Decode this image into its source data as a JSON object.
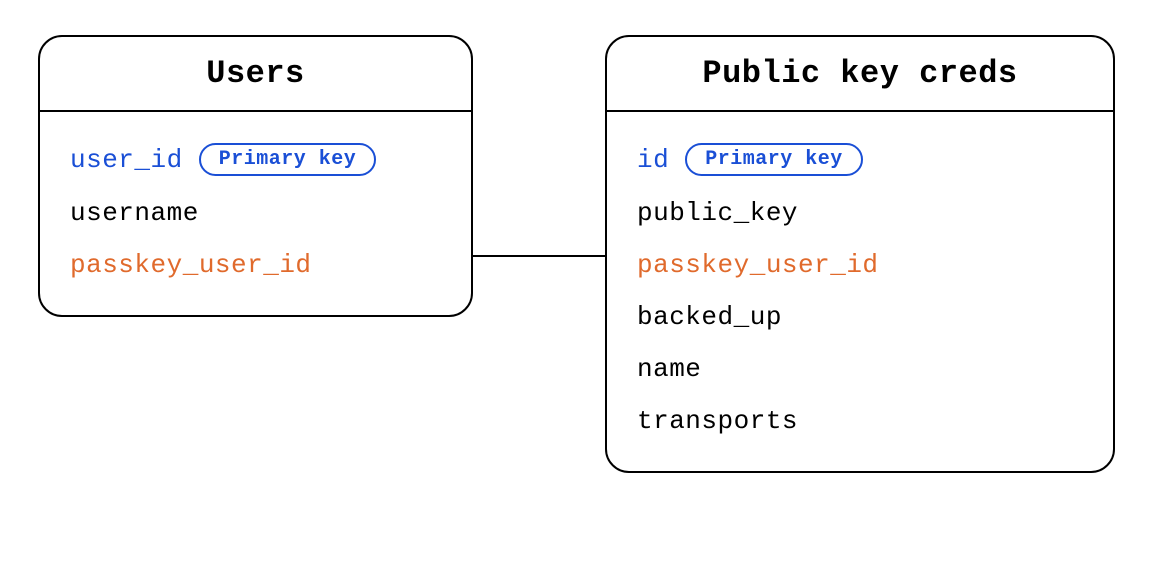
{
  "entities": {
    "users": {
      "title": "Users",
      "fields": [
        {
          "name": "user_id",
          "kind": "primary",
          "badge": "Primary key"
        },
        {
          "name": "username",
          "kind": "normal"
        },
        {
          "name": "passkey_user_id",
          "kind": "foreign"
        }
      ]
    },
    "creds": {
      "title": "Public key creds",
      "fields": [
        {
          "name": "id",
          "kind": "primary",
          "badge": "Primary key"
        },
        {
          "name": "public_key",
          "kind": "normal"
        },
        {
          "name": "passkey_user_id",
          "kind": "foreign"
        },
        {
          "name": "backed_up",
          "kind": "normal"
        },
        {
          "name": "name",
          "kind": "normal"
        },
        {
          "name": "transports",
          "kind": "normal"
        }
      ]
    }
  },
  "relationship": {
    "from": "users.passkey_user_id",
    "to": "creds.passkey_user_id"
  }
}
